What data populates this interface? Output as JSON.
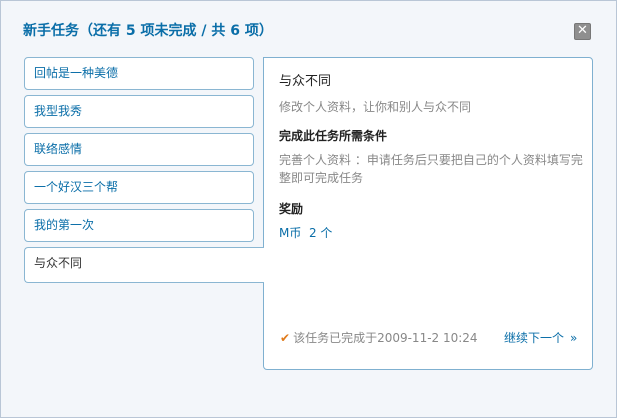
{
  "dialog": {
    "title": "新手任务（还有 5 项未完成 / 共 6 项）",
    "close_symbol": "✕"
  },
  "tasks": [
    {
      "label": "回帖是一种美德"
    },
    {
      "label": "我型我秀"
    },
    {
      "label": "联络感情"
    },
    {
      "label": "一个好汉三个帮"
    },
    {
      "label": "我的第一次"
    },
    {
      "label": "与众不同"
    }
  ],
  "detail": {
    "title": "与众不同",
    "description": "修改个人资料，让你和别人与众不同",
    "condition_heading": "完成此任务所需条件",
    "condition_text": "完善个人资料 ：申请任务后只要把自己的个人资料填写完整即可完成任务",
    "reward_heading": "奖励",
    "reward_text": "M币  2 个",
    "completed_text": "该任务已完成于2009-11-2 10:24",
    "next_label": "继续下一个",
    "next_arrow": "»"
  },
  "icons": {
    "check": "check-icon",
    "close": "close-icon"
  },
  "colors": {
    "accent": "#0a6ea8",
    "check": "#e07a1a",
    "border": "#8ab6d2"
  }
}
